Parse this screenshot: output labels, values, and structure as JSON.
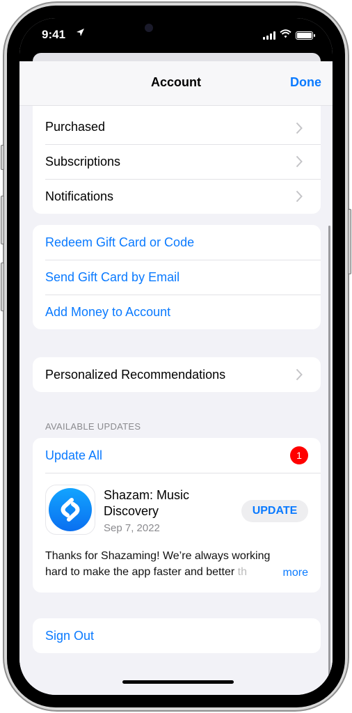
{
  "status_bar": {
    "time": "9:41",
    "location_icon": "location-arrow-icon",
    "signal_icon": "cellular-signal-icon",
    "wifi_icon": "wifi-icon",
    "battery_icon": "battery-icon"
  },
  "nav": {
    "title": "Account",
    "done_label": "Done"
  },
  "account_group": {
    "items": [
      {
        "label": "Purchased"
      },
      {
        "label": "Subscriptions"
      },
      {
        "label": "Notifications"
      }
    ]
  },
  "gift_group": {
    "items": [
      {
        "label": "Redeem Gift Card or Code"
      },
      {
        "label": "Send Gift Card by Email"
      },
      {
        "label": "Add Money to Account"
      }
    ]
  },
  "recommendations": {
    "label": "Personalized Recommendations"
  },
  "updates": {
    "header": "AVAILABLE UPDATES",
    "update_all_label": "Update All",
    "badge_count": "1",
    "app": {
      "name": "Shazam: Music Discovery",
      "date": "Sep 7, 2022",
      "update_label": "UPDATE",
      "description_line1": "Thanks for Shazaming! We’re always working",
      "description_line2": "hard to make the app faster and better ",
      "description_fade": "th",
      "more_label": "more",
      "icon": "shazam-app-icon"
    }
  },
  "sign_out": {
    "label": "Sign Out"
  },
  "colors": {
    "accent": "#0a7aff",
    "badge": "#ff0000",
    "background": "#f2f2f7",
    "secondary_text": "#8a8a8e"
  }
}
